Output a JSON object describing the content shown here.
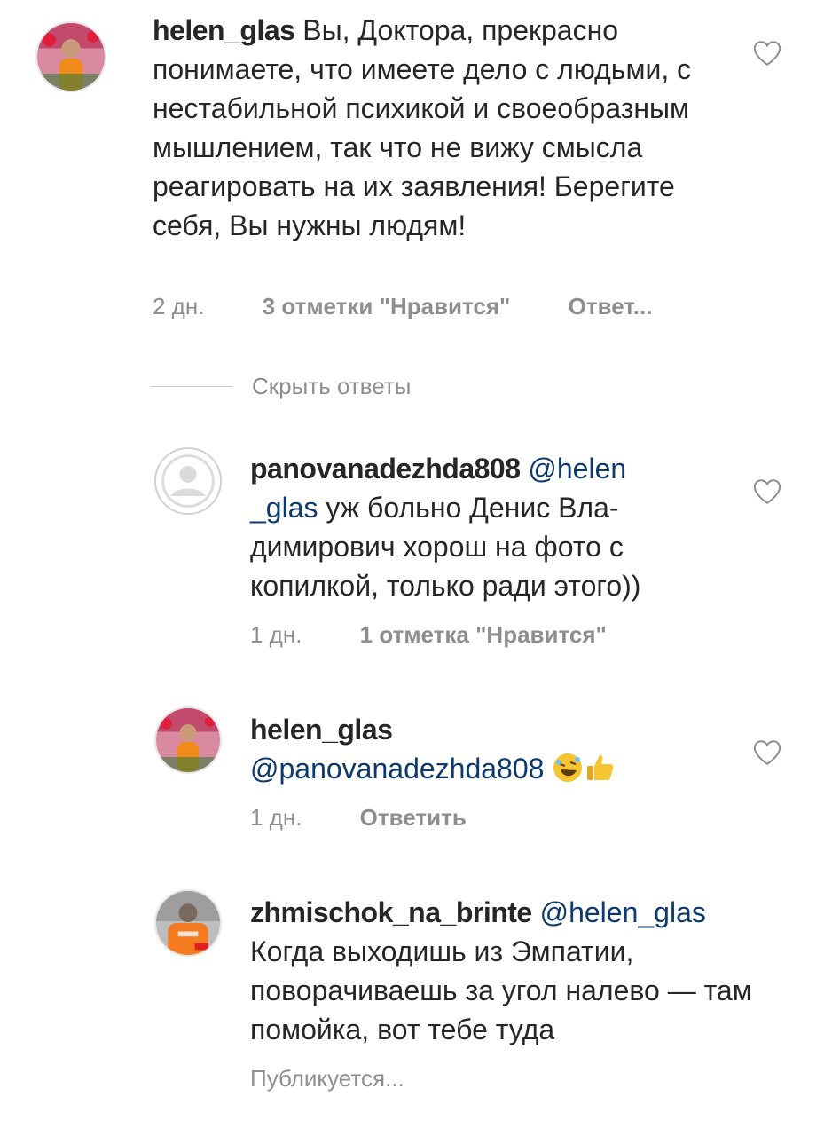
{
  "comments": [
    {
      "username": "helen_glas",
      "body": "Вы, Доктора, прекрасно понимаете, что имеете дело с людьми, с нестабильной психикой и своеобразным мышлением, так что не вижу смысла реагировать на их заявления! Берегите себя, Вы нужны людям!",
      "time": "2 дн.",
      "likes": "3 отметки \"Нравится\"",
      "reply": "Ответ..."
    },
    {
      "username": "panovanadezhda808",
      "mention_part1": "@helen",
      "mention_part2": "_glas",
      "body_part1": " уж больно Денис Вла-",
      "body_part2": "димирович хорош на фото с копилкой, только ради этого))",
      "time": "1 дн.",
      "likes": "1 отметка \"Нравится\""
    },
    {
      "username": "helen_glas",
      "mention": "@panovanadezhda808",
      "time": "1 дн.",
      "reply": "Ответить"
    },
    {
      "username": "zhmischok_na_brinte",
      "mention": "@helen_glas",
      "body": "Когда выходишь из Эмпатии, поворачиваешь за угол налево — там помойка, вот тебе туда",
      "status": "Публикуется..."
    }
  ],
  "hide_replies_label": "Скрыть ответы",
  "icons": {
    "like": "heart-outline-icon",
    "emoji1": "rofl-emoji",
    "emoji2": "thumbs-up-emoji"
  },
  "colors": {
    "text": "#262626",
    "muted": "#8e8e8e",
    "mention": "#0d3a6e"
  }
}
